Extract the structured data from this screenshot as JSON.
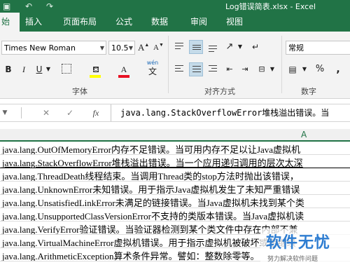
{
  "window": {
    "title": "Log错误简表.xlsx - Excel"
  },
  "tabs": [
    "始",
    "插入",
    "页面布局",
    "公式",
    "数据",
    "审阅",
    "视图"
  ],
  "ribbon": {
    "font_name": "Times New Roman",
    "font_size": "10.5",
    "bold": "B",
    "italic": "I",
    "underline": "U",
    "font_color_letter": "A",
    "grow_font": "A",
    "shrink_font": "A",
    "wen": "wén",
    "wen_char": "文",
    "number_format": "常规",
    "groups": {
      "font": "字体",
      "alignment": "对齐方式",
      "number": "数字"
    },
    "percent": "%",
    "comma": ","
  },
  "formula_bar": {
    "cancel": "✕",
    "enter": "✓",
    "fx": "fx",
    "content": "java.lang.StackOverflowError堆栈溢出错误。当"
  },
  "column_header": "A",
  "rows": [
    "java.lang.OutOfMemoryError内存不足错误。当可用内存不足以让Java虚拟机",
    "java.lang.StackOverflowError堆栈溢出错误。当一个应用递归调用的层次太深",
    "java.lang.ThreadDeath线程结束。当调用Thread类的stop方法时抛出该错误，",
    "java.lang.UnknownError未知错误。用于指示Java虚拟机发生了未知严重错误",
    "java.lang.UnsatisfiedLinkError未满足的链接错误。当Java虚拟机未找到某个类",
    "java.lang.UnsupportedClassVersionError不支持的类版本错误。当Java虚拟机读",
    "java.lang.VerifyError验证错误。当验证器检测到某个类文件中存在内部不兼",
    "java.lang.VirtualMachineError虚拟机错误。用于指示虚拟机被破坏或者继续",
    "java.lang.ArithmeticException算术条件异常。譬如：整数除零等。"
  ],
  "selected_row": 1,
  "watermark": {
    "main": "软件无忧",
    "sub": "努力解决软件问题"
  },
  "colors": {
    "excel_green": "#217346",
    "ribbon_bg": "#f3f3f3",
    "font_red": "#e81123",
    "highlight_yellow": "#ffff00",
    "watermark_blue": "#2e7dd1"
  }
}
